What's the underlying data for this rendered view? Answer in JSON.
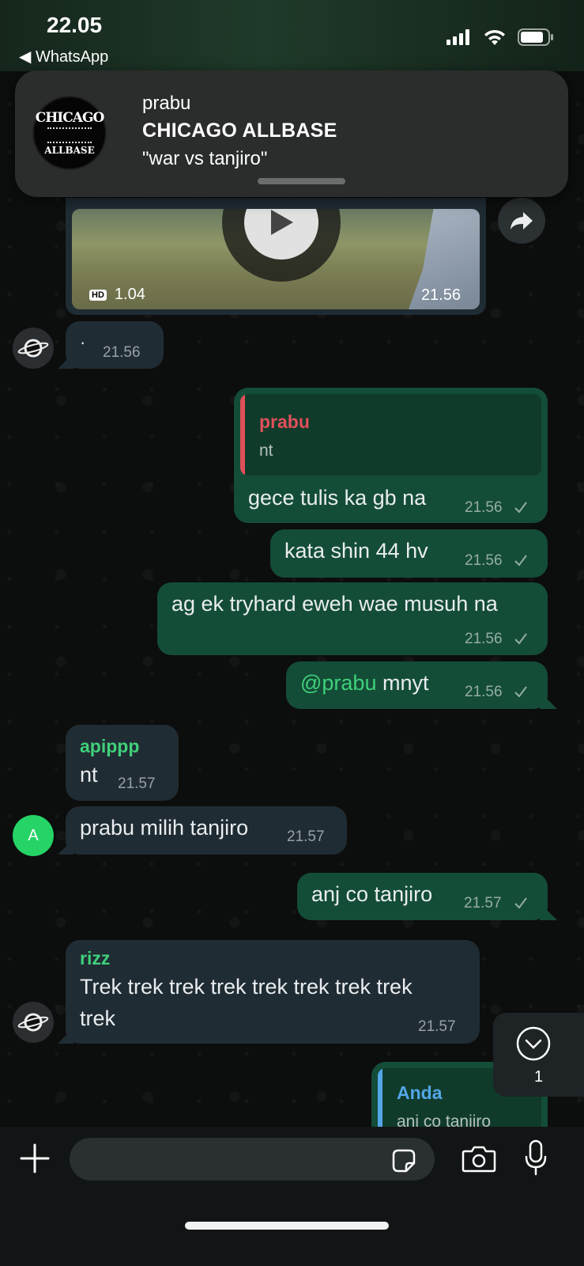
{
  "status_bar": {
    "time": "22.05",
    "back_label": "◀ WhatsApp"
  },
  "notification": {
    "sender": "prabu",
    "group": "CHICAGO ALLBASE",
    "message": "\"war vs tanjiro\"",
    "avatar_logo_top": "CHICAGO",
    "avatar_logo_bottom": "ALLBASE"
  },
  "video_message": {
    "duration": "1.04",
    "time": "21.56",
    "quality_badge": "HD"
  },
  "messages": [
    {
      "type": "incoming",
      "text": "·",
      "time": "21.56"
    },
    {
      "type": "outgoing",
      "quote_name": "prabu",
      "quote_text": "nt",
      "text": "gece tulis ka gb na",
      "time": "21.56"
    },
    {
      "type": "outgoing",
      "text": "kata shin 44 hv",
      "time": "21.56"
    },
    {
      "type": "outgoing",
      "text": "ag ek tryhard eweh wae musuh na",
      "time": "21.56"
    },
    {
      "type": "outgoing",
      "mention": "@prabu",
      "text": " mnyt",
      "time": "21.56"
    },
    {
      "type": "incoming",
      "sender": "apippp",
      "text": "nt",
      "time": "21.57"
    },
    {
      "type": "incoming",
      "text": "prabu milih tanjiro",
      "time": "21.57",
      "avatar_letter": "A"
    },
    {
      "type": "outgoing",
      "text": "anj co tanjiro",
      "time": "21.57"
    },
    {
      "type": "incoming",
      "sender": "rizz",
      "text_line1": "Trek trek trek trek trek trek trek trek",
      "text_line2": "trek",
      "time": "21.57"
    },
    {
      "type": "outgoing",
      "quote_name": "Anda",
      "quote_text": "anj co tanjiro"
    }
  ],
  "scroll_button": {
    "unread_count": "1"
  },
  "colors": {
    "outgoing_bubble": "#144d37",
    "incoming_bubble": "#202c33",
    "sender_apippp": "#3fd07b",
    "sender_rizz": "#3fd07b",
    "quote_prabu": "#e0505a",
    "quote_anda": "#53a6e7",
    "mention": "#3fd07b"
  },
  "icons": [
    "signal-icon",
    "wifi-icon",
    "battery-icon",
    "play-icon",
    "forward-icon",
    "check-icon",
    "chevron-down-icon",
    "plus-icon",
    "sticker-icon",
    "camera-icon",
    "mic-icon"
  ]
}
